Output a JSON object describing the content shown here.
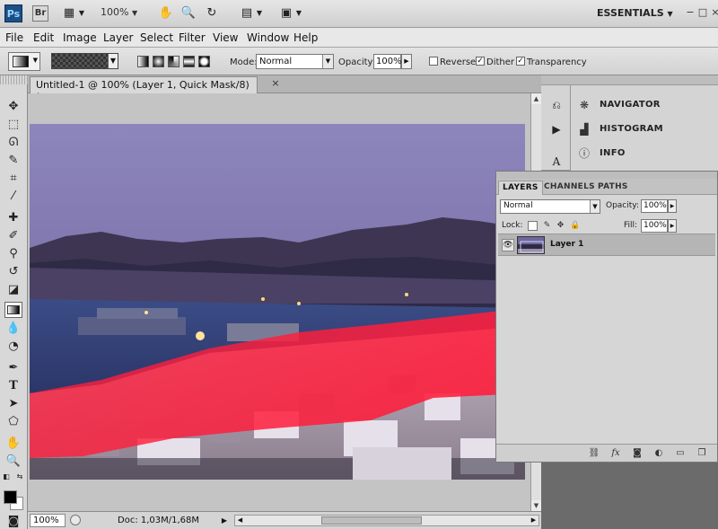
{
  "appbar": {
    "ps_logo": "Ps",
    "br_logo": "Br",
    "zoom": "100%",
    "workspace": "ESSENTIALS",
    "icons": [
      "film-strip-icon",
      "hand-icon",
      "zoom-icon",
      "rotate-view-icon",
      "arrange-documents-icon",
      "screen-mode-icon"
    ],
    "window_controls": [
      "−",
      "□",
      "×"
    ]
  },
  "menu": [
    "File",
    "Edit",
    "Image",
    "Layer",
    "Select",
    "Filter",
    "View",
    "Window",
    "Help"
  ],
  "options": {
    "mode_label": "Mode:",
    "mode_value": "Normal",
    "opacity_label": "Opacity:",
    "opacity_value": "100%",
    "reverse_label": "Reverse",
    "reverse_checked": false,
    "dither_label": "Dither",
    "dither_checked": true,
    "transparency_label": "Transparency",
    "transparency_checked": true
  },
  "document": {
    "tab_title": "Untitled-1 @ 100% (Layer 1, Quick Mask/8) *",
    "close": "×"
  },
  "status": {
    "zoom": "100%",
    "doc_info": "Doc: 1,03M/1,68M"
  },
  "side_panels": [
    {
      "label": "NAVIGATOR",
      "icon": "navigator-icon"
    },
    {
      "label": "HISTOGRAM",
      "icon": "histogram-icon"
    },
    {
      "label": "INFO",
      "icon": "info-icon"
    }
  ],
  "layers_panel": {
    "tabs": [
      "LAYERS",
      "CHANNELS",
      "PATHS"
    ],
    "blend_mode": "Normal",
    "opacity_label": "Opacity:",
    "opacity_value": "100%",
    "lock_label": "Lock:",
    "fill_label": "Fill:",
    "fill_value": "100%",
    "layers": [
      {
        "name": "Layer 1",
        "visible": true
      }
    ]
  },
  "colors": {
    "quick_mask_overlay": "#ff1e3c",
    "foreground": "#000000",
    "background": "#ffffff"
  }
}
